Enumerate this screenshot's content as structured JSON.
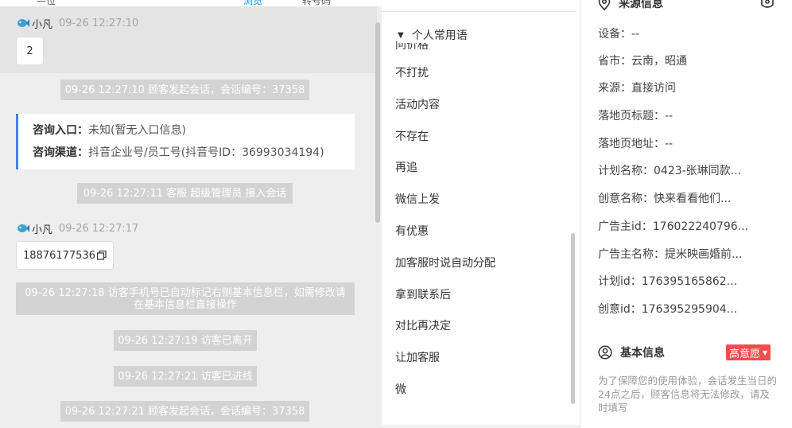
{
  "chat": {
    "top_fragments": [
      "—位",
      "浏览",
      "转号码"
    ],
    "messages": [
      {
        "sender": "小凡",
        "time": "09-26 12:27:10",
        "content": "2"
      },
      {
        "sender": "小凡",
        "time": "09-26 12:27:17",
        "content": "18876177536"
      }
    ],
    "system": [
      "09-26 12:27:10 顾客发起会话，会话编号：37358",
      "09-26 12:27:11 客服 超级管理员 接入会话",
      "09-26 12:27:18 访客手机号已自动标记右侧基本信息栏，如需修改请在基本信息栏直接操作",
      "09-26 12:27:19 访客已离开",
      "09-26 12:27:21 访客已进线",
      "09-26 12:27:21 顾客发起会话，会话编号：37358"
    ],
    "entry_card": {
      "entry_label": "咨询入口：",
      "entry_value": "未知(暂无入口信息)",
      "channel_label": "咨询渠道：",
      "channel_value": "抖音企业号/员工号(抖音号ID：36993034194)"
    }
  },
  "phrases": {
    "group_label": "个人常用语",
    "ghost_item": "问价格",
    "items": [
      "不打扰",
      "活动内容",
      "不存在",
      "再追",
      "微信上发",
      "有优惠",
      "加客服时说自动分配",
      "拿到联系后",
      "对比再决定",
      "让加客服",
      "微"
    ]
  },
  "source": {
    "title": "来源信息",
    "fields": [
      "设备：--",
      "省市：云南，昭通",
      "来源：直接访问",
      "落地页标题：--",
      "落地页地址：--",
      "计划名称：0423-张琳同款...",
      "创意名称：快来看看他们...",
      "广告主id：176022240796...",
      "广告主名称：提米映画婚前...",
      "计划id：176395165862...",
      "创意id：176395295904..."
    ],
    "basic_title": "基本信息",
    "intent_badge": "高意愿",
    "notice": "为了保障您的使用体验，会话发生当日的24点之后，顾客信息将无法修改，请及时填写"
  }
}
